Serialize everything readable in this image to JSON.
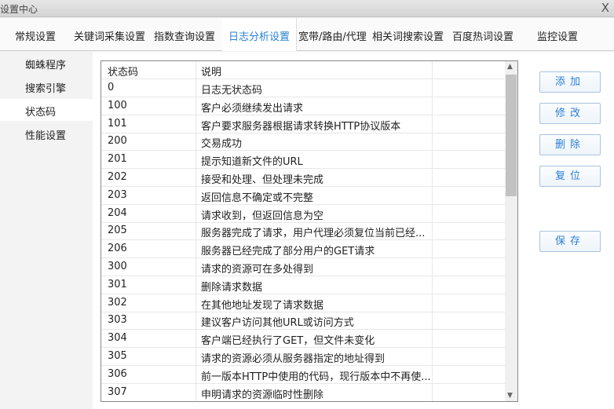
{
  "window": {
    "title": "设置中心",
    "close": "X"
  },
  "tabs": [
    "常规设置",
    "关键词采集设置",
    "指数查询设置",
    "日志分析设置",
    "宽带/路由/代理",
    "相关词搜索设置",
    "百度热词设置",
    "监控设置"
  ],
  "active_tab": "日志分析设置",
  "sidebar": [
    "蜘蛛程序",
    "搜索引擎",
    "状态码",
    "性能设置"
  ],
  "table": {
    "headers": [
      "状态码",
      "说明"
    ],
    "rows": [
      [
        "0",
        "日志无状态码"
      ],
      [
        "100",
        "客户必须继续发出请求"
      ],
      [
        "101",
        "客户要求服务器根据请求转换HTTP协议版本"
      ],
      [
        "200",
        "交易成功"
      ],
      [
        "201",
        "提示知道新文件的URL"
      ],
      [
        "202",
        "接受和处理、但处理未完成"
      ],
      [
        "203",
        "返回信息不确定或不完整"
      ],
      [
        "204",
        "请求收到，但返回信息为空"
      ],
      [
        "205",
        "服务器完成了请求，用户代理必须复位当前已经..."
      ],
      [
        "206",
        "服务器已经完成了部分用户的GET请求"
      ],
      [
        "300",
        "请求的资源可在多处得到"
      ],
      [
        "301",
        "删除请求数据"
      ],
      [
        "302",
        "在其他地址发现了请求数据"
      ],
      [
        "303",
        "建议客户访问其他URL或访问方式"
      ],
      [
        "304",
        "客户端已经执行了GET，但文件未变化"
      ],
      [
        "305",
        "请求的资源必须从服务器指定的地址得到"
      ],
      [
        "306",
        "前一版本HTTP中使用的代码，现行版本中不再使..."
      ],
      [
        "307",
        "申明请求的资源临时性删除"
      ]
    ]
  },
  "buttons": {
    "add": "添加",
    "edit": "修改",
    "delete": "删除",
    "reset": "复位",
    "save": "保存"
  }
}
